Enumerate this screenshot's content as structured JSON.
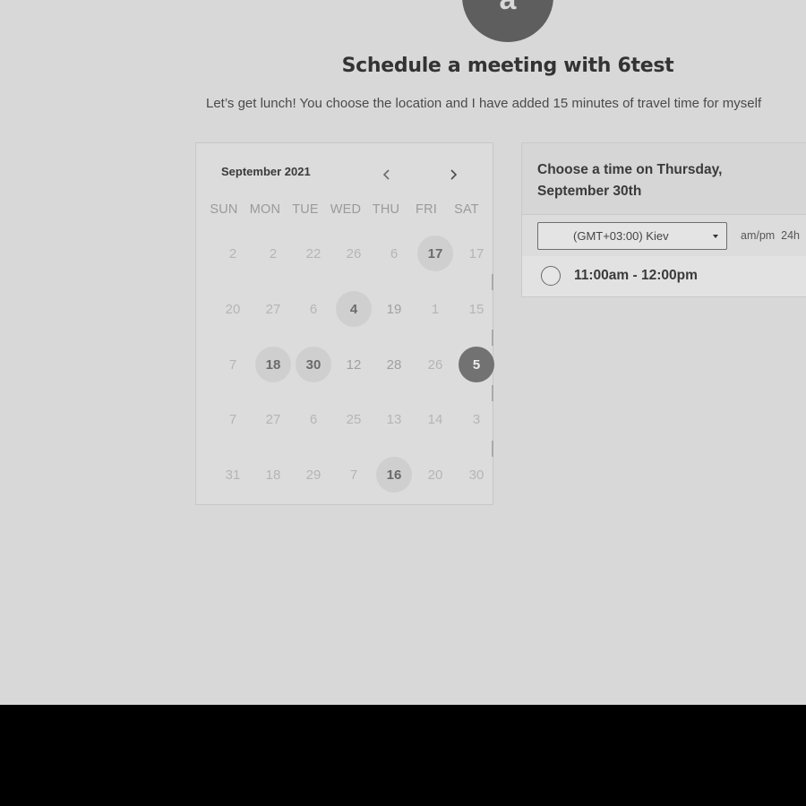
{
  "host": {
    "avatar_initial": "a"
  },
  "page": {
    "title": "Schedule a meeting with 6test",
    "description": "Let’s get lunch! You choose the location and I have added 15 minutes of travel time for myself"
  },
  "calendar": {
    "month_label": "September 2021",
    "prev_icon": "chevron-left-icon",
    "next_icon": "chevron-right-icon",
    "weekdays": [
      "SUN",
      "MON",
      "TUE",
      "WED",
      "THU",
      "FRI",
      "SAT"
    ],
    "weeks": [
      [
        {
          "d": "2",
          "s": "dim"
        },
        {
          "d": "2",
          "s": "dim"
        },
        {
          "d": "22",
          "s": "dim"
        },
        {
          "d": "26",
          "s": "dim"
        },
        {
          "d": "6",
          "s": "dim"
        },
        {
          "d": "17",
          "s": "available"
        },
        {
          "d": "17",
          "s": "dim"
        }
      ],
      [
        {
          "d": "20",
          "s": "dim"
        },
        {
          "d": "27",
          "s": "dim"
        },
        {
          "d": "6",
          "s": "dim"
        },
        {
          "d": "4",
          "s": "available"
        },
        {
          "d": "19",
          "s": "plain"
        },
        {
          "d": "1",
          "s": "dim"
        },
        {
          "d": "15",
          "s": "dim"
        }
      ],
      [
        {
          "d": "7",
          "s": "dim"
        },
        {
          "d": "18",
          "s": "available"
        },
        {
          "d": "30",
          "s": "available"
        },
        {
          "d": "12",
          "s": "plain"
        },
        {
          "d": "28",
          "s": "plain"
        },
        {
          "d": "26",
          "s": "dim"
        },
        {
          "d": "5",
          "s": "selected"
        }
      ],
      [
        {
          "d": "7",
          "s": "dim"
        },
        {
          "d": "27",
          "s": "dim"
        },
        {
          "d": "6",
          "s": "dim"
        },
        {
          "d": "25",
          "s": "dim"
        },
        {
          "d": "13",
          "s": "dim"
        },
        {
          "d": "14",
          "s": "dim"
        },
        {
          "d": "3",
          "s": "dim"
        }
      ],
      [
        {
          "d": "31",
          "s": "dim"
        },
        {
          "d": "18",
          "s": "dim"
        },
        {
          "d": "29",
          "s": "dim"
        },
        {
          "d": "7",
          "s": "dim"
        },
        {
          "d": "16",
          "s": "available"
        },
        {
          "d": "20",
          "s": "dim"
        },
        {
          "d": "30",
          "s": "dim"
        }
      ]
    ]
  },
  "time_panel": {
    "heading": "Choose a time on Thursday, September 30th",
    "timezone_value": "(GMT+03:00) Kiev",
    "format_options": [
      "am/pm",
      "24h"
    ],
    "slots": [
      "11:00am - 12:00pm"
    ]
  },
  "colors": {
    "background": "#d8d8d8",
    "selected_day": "#727272",
    "available_day": "#cfcfcf",
    "bottom_band": "#000000"
  }
}
